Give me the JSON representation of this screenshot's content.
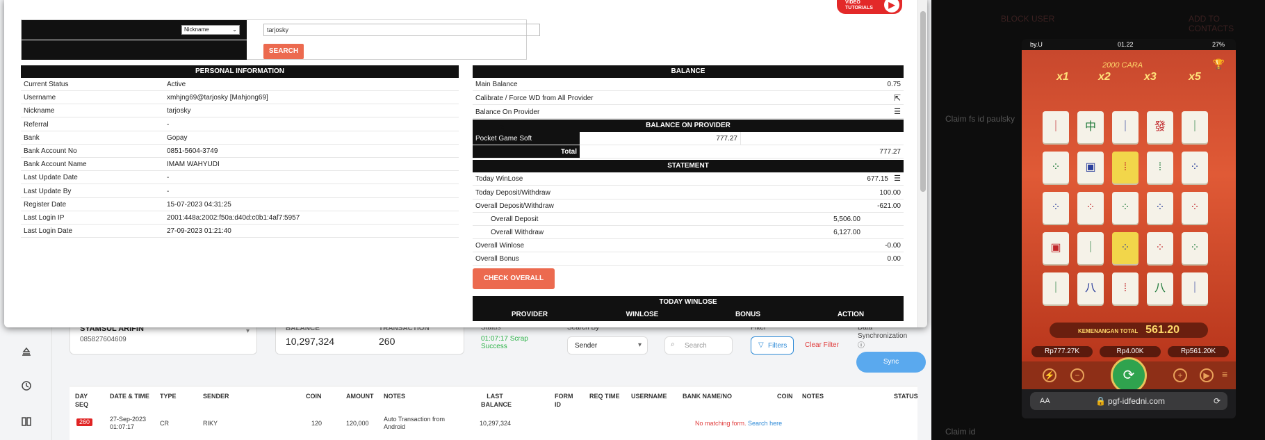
{
  "yt_badge": {
    "line1": "VIDEO",
    "line2": "TUTORIALS"
  },
  "search": {
    "select_value": "Nickname",
    "input_value": "tarjosky",
    "button_label": "SEARCH"
  },
  "personal": {
    "title": "PERSONAL INFORMATION",
    "rows": [
      {
        "k": "Current Status",
        "v": "Active"
      },
      {
        "k": "Username",
        "v": "xmhjng69@tarjosky  [Mahjong69]"
      },
      {
        "k": "Nickname",
        "v": "tarjosky"
      },
      {
        "k": "Referral",
        "v": "-"
      },
      {
        "k": "Bank",
        "v": "Gopay"
      },
      {
        "k": "Bank Account No",
        "v": "0851-5604-3749"
      },
      {
        "k": "Bank Account Name",
        "v": "IMAM WAHYUDI"
      },
      {
        "k": "Last Update Date",
        "v": "-"
      },
      {
        "k": "Last Update By",
        "v": "-"
      },
      {
        "k": "Register Date",
        "v": "15-07-2023 04:31:25"
      },
      {
        "k": "Last Login IP",
        "v": "2001:448a:2002:f50a:d40d:c0b1:4af7:5957"
      },
      {
        "k": "Last Login Date",
        "v": "27-09-2023 01:21:40"
      }
    ]
  },
  "balance": {
    "title": "BALANCE",
    "main_label": "Main Balance",
    "main_value": "0.75",
    "calibrate_label": "Calibrate / Force WD from All Provider",
    "on_provider_label": "Balance On Provider",
    "on_provider_title": "BALANCE ON PROVIDER",
    "provider_name": "Pocket Game Soft",
    "provider_value": "777.27",
    "total_label": "Total",
    "total_value": "777.27"
  },
  "statement": {
    "title": "STATEMENT",
    "today_winlose_label": "Today WinLose",
    "today_winlose_value": "677.15",
    "today_dw_label": "Today Deposit/Withdraw",
    "today_dw_value": "100.00",
    "overall_dw_label": "Overall Deposit/Withdraw",
    "overall_dw_value": "-621.00",
    "overall_deposit_label": "Overall Deposit",
    "overall_deposit_value": "5,506.00",
    "overall_withdraw_label": "Overall Withdraw",
    "overall_withdraw_value": "6,127.00",
    "overall_winlose_label": "Overall Winlose",
    "overall_winlose_value": "-0.00",
    "overall_bonus_label": "Overall Bonus",
    "overall_bonus_value": "0.00",
    "check_button": "CHECK OVERALL"
  },
  "today_winlose": {
    "title": "TODAY WINLOSE",
    "columns": [
      "PROVIDER",
      "WINLOSE",
      "BONUS",
      "ACTION"
    ]
  },
  "bg": {
    "customer_name": "SYAMSUL ARIFIN",
    "customer_phone": "085827604609",
    "balance_label": "BALANCE",
    "balance_value": "10,297,324",
    "transaction_label": "TRANSACTION",
    "transaction_value": "260",
    "status_label": "Status",
    "status_time": "01:07:17",
    "status_scrap": "Scrap",
    "status_success": "Success",
    "search_by_label": "Search By",
    "search_by_value": "Sender",
    "search_placeholder": "Search",
    "filter_label": "Filter",
    "filters_button": "Filters",
    "clear_filter": "Clear Filter",
    "sync_label": "Data Synchronization",
    "sync_button": "Sync",
    "columns": [
      "DAY SEQ",
      "DATE & TIME",
      "TYPE",
      "SENDER",
      "COIN",
      "AMOUNT",
      "NOTES",
      "LAST BALANCE",
      "FORM ID",
      "REQ TIME",
      "USERNAME",
      "BANK NAME/NO",
      "COIN",
      "NOTES",
      "STATUS"
    ],
    "row": {
      "seq": "260",
      "date": "27-Sep-2023",
      "time": "01:07:17",
      "type": "CR",
      "sender": "RIKY",
      "coin": "120",
      "amount": "120,000",
      "notes": "Auto Transaction from Android",
      "last_balance": "10,297,324",
      "no_match": "No matching form.",
      "search_here": "Search here"
    }
  },
  "right_bg": {
    "block_user": "BLOCK USER",
    "add_contact": "ADD TO CONTACTS",
    "claim1": "Claim fs id paulsky",
    "claim2": "Claim id"
  },
  "phone": {
    "carrier": "by.U",
    "time": "01.22",
    "battery": "27%",
    "url": "pgf-idfedni.com",
    "aa": "AA",
    "multipliers": [
      "x1",
      "x2",
      "x3",
      "x5"
    ],
    "win_label": "KEMENANGAN TOTAL",
    "win_value": "561.20",
    "pill1": "Rp777.27K",
    "pill2": "Rp4.00K",
    "pill3": "Rp561.20K",
    "header_text": "2000 CARA"
  }
}
